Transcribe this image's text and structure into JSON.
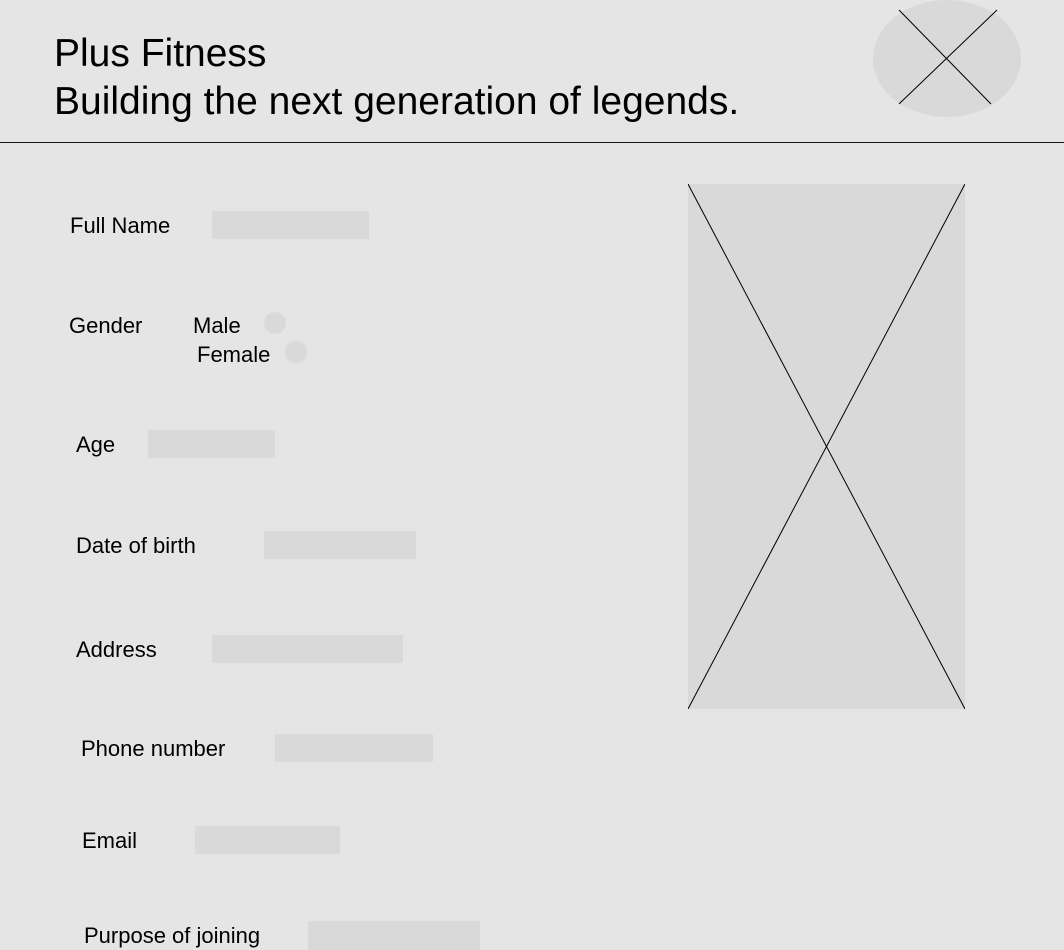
{
  "header": {
    "title": "Plus Fitness",
    "tagline": "Building the next generation of legends."
  },
  "form": {
    "full_name": {
      "label": "Full Name",
      "value": ""
    },
    "gender": {
      "label": "Gender",
      "options": [
        {
          "label": "Male",
          "selected": false
        },
        {
          "label": "Female",
          "selected": false
        }
      ]
    },
    "age": {
      "label": "Age",
      "value": ""
    },
    "dob": {
      "label": "Date of birth",
      "value": ""
    },
    "address": {
      "label": "Address",
      "value": ""
    },
    "phone": {
      "label": "Phone number",
      "value": ""
    },
    "email": {
      "label": "Email",
      "value": ""
    },
    "purpose": {
      "label": "Purpose of joining",
      "value": ""
    }
  },
  "icons": {
    "logo": "image-placeholder-icon",
    "photo": "image-placeholder-icon"
  },
  "colors": {
    "background": "#e5e5e5",
    "placeholder_fill": "#d9d9d9",
    "text": "#000000"
  }
}
